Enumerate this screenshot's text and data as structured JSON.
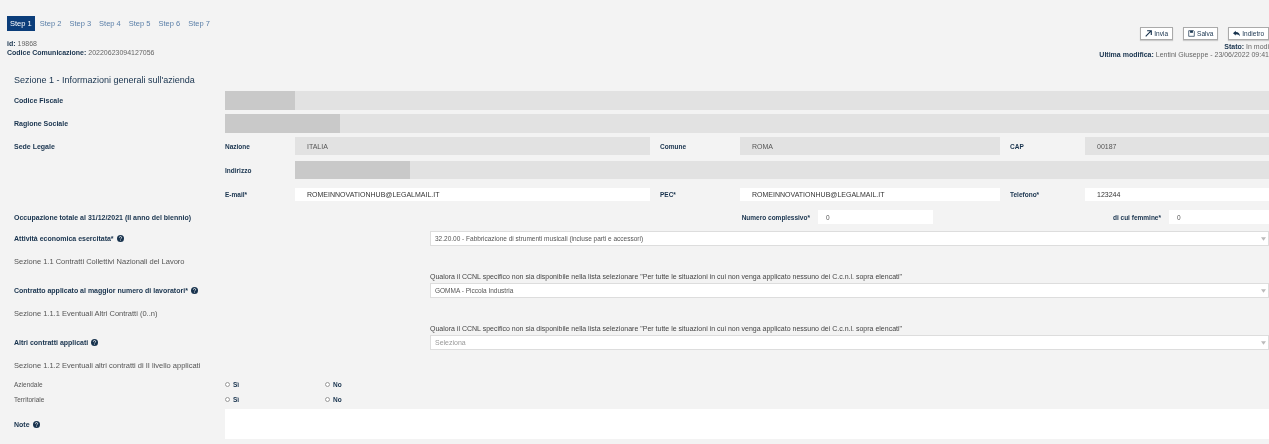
{
  "steps": [
    {
      "label": "Step 1",
      "selected": true
    },
    {
      "label": "Step 2",
      "selected": false
    },
    {
      "label": "Step 3",
      "selected": false
    },
    {
      "label": "Step 4",
      "selected": false
    },
    {
      "label": "Step 5",
      "selected": false
    },
    {
      "label": "Step 6",
      "selected": false
    },
    {
      "label": "Step 7",
      "selected": false
    }
  ],
  "meta": [
    {
      "label": "id:",
      "value": "19868"
    },
    {
      "label": "Codice Comunicazione:",
      "value": "20220623094127056"
    }
  ],
  "actions": [
    {
      "label": "Invia"
    },
    {
      "label": "Salva"
    },
    {
      "label": "Indietro"
    }
  ],
  "status": {
    "label": "Stato:",
    "value": "In modi"
  },
  "last_modified": {
    "label": "Ultima modifica:",
    "value": "Lentini Giuseppe - 23/06/2022 09:41"
  },
  "section_title": "Sezione 1 - Informazioni generali sull'azienda",
  "company_fields": [
    {
      "label": "Codice Fiscale",
      "redacted": true
    },
    {
      "label": "Ragione Sociale",
      "redacted": true
    }
  ],
  "sede_legale": {
    "label": "Sede Legale",
    "rows": [
      [
        {
          "label": "Nazione",
          "value": "ITALIA",
          "readonly": true
        },
        {
          "label": "Comune",
          "value": "ROMA",
          "readonly": true
        },
        {
          "label": "CAP",
          "value": "00187",
          "readonly": true
        }
      ],
      [
        {
          "label": "Indirizzo",
          "redacted": true,
          "readonly": true
        }
      ],
      [
        {
          "label": "E-mail*",
          "value": "ROMEINNOVATIONHUB@LEGALMAIL.IT",
          "readonly": false
        },
        {
          "label": "PEC*",
          "value": "ROMEINNOVATIONHUB@LEGALMAIL.IT",
          "readonly": false
        },
        {
          "label": "Telefono*",
          "value": "123244",
          "readonly": false
        }
      ]
    ]
  },
  "occupazione": {
    "label": "Occupazione totale al 31/12/2021 (II anno del biennio)",
    "fields": [
      {
        "label": "Numero complessivo*",
        "value": "0"
      },
      {
        "label": "di cui femmine*",
        "value": "0"
      }
    ]
  },
  "blocks": [
    {
      "kind": "select",
      "label": "Attività economica esercitata*",
      "help": true,
      "value": "32.20.00 - Fabbricazione di strumenti musicali (incluse parti e accessori)"
    },
    {
      "kind": "subsection",
      "text": "Sezione 1.1 Contratti Collettivi Nazionali del Lavoro"
    },
    {
      "kind": "select",
      "label": "Contratto applicato al maggior numero di lavoratori*",
      "help": true,
      "hint": "Qualora il CCNL specifico non sia disponibile nella lista selezionare \"Per tutte le situazioni in cui non venga applicato nessuno dei C.c.n.l. sopra elencati\"",
      "value": "GOMMA - Piccola Industria"
    },
    {
      "kind": "subsection",
      "text": "Sezione 1.1.1 Eventuali Altri Contratti (0..n)"
    },
    {
      "kind": "select",
      "label": "Altri contratti applicati",
      "help": true,
      "hint": "Qualora il CCNL specifico non sia disponibile nella lista selezionare \"Per tutte le situazioni in cui non venga applicato nessuno dei C.c.n.l. sopra elencati\"",
      "placeholder": "Seleziona"
    },
    {
      "kind": "subsection",
      "text": "Sezione 1.1.2 Eventuali altri contratti di II livello applicati"
    },
    {
      "kind": "radio",
      "label": "Aziendale",
      "options": [
        {
          "label": "Sì",
          "selected": false
        },
        {
          "label": "No",
          "selected": false
        }
      ]
    },
    {
      "kind": "radio",
      "label": "Territoriale",
      "options": [
        {
          "label": "Sì",
          "selected": false
        },
        {
          "label": "No",
          "selected": false
        }
      ]
    },
    {
      "kind": "textarea",
      "label": "Note",
      "help": true
    }
  ]
}
